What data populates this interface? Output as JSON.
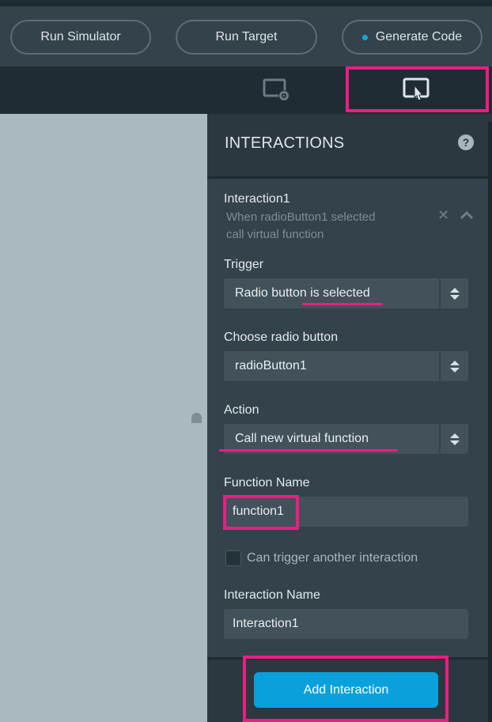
{
  "toolbar": {
    "run_simulator": "Run Simulator",
    "run_target": "Run Target",
    "generate_code": "Generate Code"
  },
  "tabs": [
    {
      "icon": "screen-settings-icon",
      "active": false
    },
    {
      "icon": "interaction-pointer-icon",
      "active": true
    }
  ],
  "panel": {
    "title": "INTERACTIONS",
    "help": "?"
  },
  "interaction": {
    "name": "Interaction1",
    "description_line1": "When radioButton1 selected",
    "description_line2": "call virtual function",
    "trigger_label": "Trigger",
    "trigger_value": "Radio button is selected",
    "radio_label": "Choose radio button",
    "radio_value": "radioButton1",
    "action_label": "Action",
    "action_value": "Call new virtual function",
    "function_name_label": "Function Name",
    "function_name_value": "function1",
    "can_trigger_label": "Can trigger another interaction",
    "can_trigger_checked": false,
    "interaction_name_label": "Interaction Name",
    "interaction_name_value": "Interaction1"
  },
  "footer": {
    "add_button": "Add Interaction"
  },
  "colors": {
    "highlight": "#ee1c84",
    "primary_button": "#0aa0dc",
    "dot": "#1ca2e0"
  }
}
